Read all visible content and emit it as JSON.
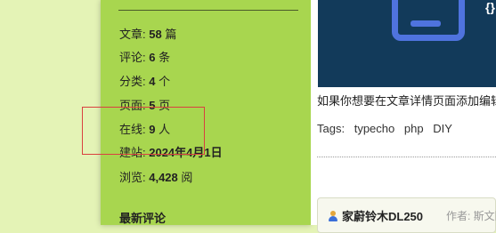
{
  "sidebar": {
    "stats": [
      {
        "label": "文章: ",
        "value": "58",
        "unit": " 篇"
      },
      {
        "label": "评论: ",
        "value": "6",
        "unit": " 条"
      },
      {
        "label": "分类: ",
        "value": "4",
        "unit": " 个"
      },
      {
        "label": "页面: ",
        "value": "5",
        "unit": " 页"
      },
      {
        "label": "在线: ",
        "value": "9",
        "unit": " 人"
      },
      {
        "label": "建站: ",
        "value": "2024年4月1日",
        "unit": ""
      },
      {
        "label": "浏览: ",
        "value": "4,428",
        "unit": " 阅"
      }
    ],
    "recent_comments_heading": "最新评论"
  },
  "main": {
    "banner_glyph": "{}",
    "excerpt": "如果你想要在文章详情页面添加编辑",
    "tags_label": "Tags:",
    "tags": [
      "typecho",
      "php",
      "DIY"
    ],
    "card": {
      "title": "家蔚铃木DL250",
      "author": "作者: 斯文阳"
    }
  },
  "colors": {
    "sidebar_bg": "#a8d64f",
    "page_bg": "#e4f3b6",
    "banner_bg": "#123a5a",
    "icon_blue": "#4f73de",
    "highlight_border": "#d94040"
  }
}
